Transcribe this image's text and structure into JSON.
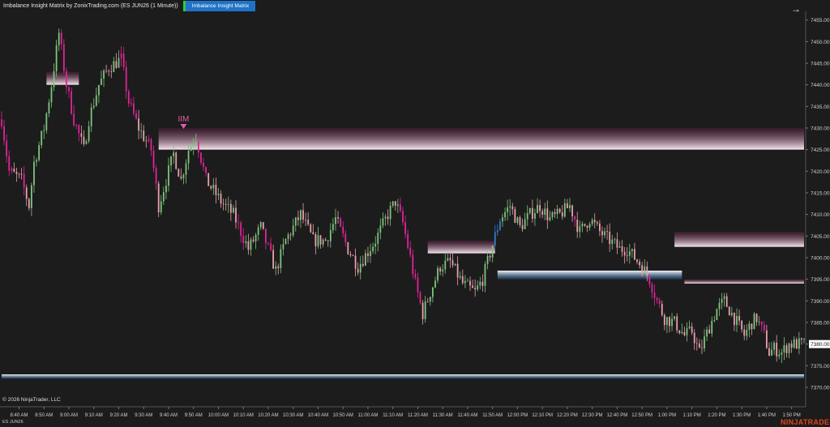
{
  "header": {
    "title": "Imbalance Insight Matrix by ZonixTrading.com (ES JUN26 (1 Minute))",
    "indicator_button": "Imbalance Insight Matrix"
  },
  "footer": {
    "copyright": "© 2026 NinjaTrader, LLC",
    "symbol": "ES JUN26",
    "brand": "NINJATRADER"
  },
  "colors": {
    "background": "#1c1c1c",
    "up_candle": "#7ec47e",
    "down_candle": "#e8a0ad",
    "magenta": "#e0249a",
    "blue": "#2d7fd1",
    "bearish_zone": "#f0dce8",
    "bullish_zone": "#d8e6f4",
    "price_marker": "#ffffff"
  },
  "chart_data": {
    "type": "candlestick",
    "ylim": [
      7370,
      7457
    ],
    "y_ticks": [
      "7455.00",
      "7450.00",
      "7445.00",
      "7440.00",
      "7435.00",
      "7430.00",
      "7425.00",
      "7420.00",
      "7415.00",
      "7410.00",
      "7405.00",
      "7400.00",
      "7395.00",
      "7390.00",
      "7385.00",
      "7380.00",
      "7375.00",
      "7370.00"
    ],
    "x_ticks": [
      "8:40 AM",
      "8:50 AM",
      "9:00 AM",
      "9:10 AM",
      "9:20 AM",
      "9:30 AM",
      "9:40 AM",
      "9:50 AM",
      "10:00 AM",
      "10:10 AM",
      "10:20 AM",
      "10:30 AM",
      "10:40 AM",
      "10:50 AM",
      "11:00 AM",
      "11:10 AM",
      "11:20 AM",
      "11:30 AM",
      "11:40 AM",
      "11:50 AM",
      "12:00 PM",
      "12:10 PM",
      "12:20 PM",
      "12:30 PM",
      "12:40 PM",
      "12:50 PM",
      "1:00 PM",
      "1:10 PM",
      "1:20 PM",
      "1:30 PM",
      "1:40 PM",
      "1:50 PM"
    ],
    "start_time": "8:33 AM",
    "end_time": "1:55 PM",
    "current_price": "7380.00",
    "price_path": [
      [
        0,
        7432
      ],
      [
        3,
        7420
      ],
      [
        8,
        7418
      ],
      [
        11,
        7412
      ],
      [
        13,
        7422
      ],
      [
        17,
        7430
      ],
      [
        20,
        7440
      ],
      [
        23,
        7452
      ],
      [
        26,
        7440
      ],
      [
        29,
        7432
      ],
      [
        33,
        7425
      ],
      [
        35,
        7432
      ],
      [
        39,
        7440
      ],
      [
        43,
        7444
      ],
      [
        48,
        7446
      ],
      [
        51,
        7436
      ],
      [
        55,
        7430
      ],
      [
        60,
        7425
      ],
      [
        63,
        7412
      ],
      [
        66,
        7418
      ],
      [
        69,
        7424
      ],
      [
        72,
        7418
      ],
      [
        75,
        7425
      ],
      [
        78,
        7428
      ],
      [
        82,
        7418
      ],
      [
        88,
        7413
      ],
      [
        93,
        7410
      ],
      [
        99,
        7402
      ],
      [
        104,
        7407
      ],
      [
        110,
        7397
      ],
      [
        114,
        7404
      ],
      [
        120,
        7410
      ],
      [
        125,
        7404
      ],
      [
        130,
        7404
      ],
      [
        134,
        7409
      ],
      [
        139,
        7402
      ],
      [
        143,
        7398
      ],
      [
        150,
        7404
      ],
      [
        155,
        7410
      ],
      [
        158,
        7413
      ],
      [
        161,
        7408
      ],
      [
        164,
        7400
      ],
      [
        166,
        7394
      ],
      [
        169,
        7387
      ],
      [
        172,
        7392
      ],
      [
        176,
        7398
      ],
      [
        180,
        7399
      ],
      [
        185,
        7394
      ],
      [
        190,
        7392
      ],
      [
        193,
        7395
      ],
      [
        197,
        7403
      ],
      [
        200,
        7409
      ],
      [
        204,
        7412
      ],
      [
        208,
        7407
      ],
      [
        212,
        7410
      ],
      [
        216,
        7412
      ],
      [
        220,
        7409
      ],
      [
        224,
        7410
      ],
      [
        228,
        7412
      ],
      [
        232,
        7406
      ],
      [
        236,
        7409
      ],
      [
        240,
        7406
      ],
      [
        244,
        7404
      ],
      [
        248,
        7402
      ],
      [
        251,
        7402
      ],
      [
        254,
        7400
      ],
      [
        257,
        7398
      ],
      [
        260,
        7395
      ],
      [
        263,
        7390
      ],
      [
        266,
        7386
      ],
      [
        270,
        7385
      ],
      [
        274,
        7382
      ],
      [
        277,
        7383
      ],
      [
        280,
        7378
      ],
      [
        284,
        7384
      ],
      [
        287,
        7388
      ],
      [
        290,
        7390
      ],
      [
        294,
        7386
      ],
      [
        298,
        7382
      ],
      [
        301,
        7385
      ],
      [
        303,
        7386
      ],
      [
        306,
        7382
      ],
      [
        308,
        7378
      ],
      [
        310,
        7379
      ],
      [
        313,
        7378
      ],
      [
        316,
        7380
      ],
      [
        322,
        7380
      ]
    ],
    "zones": [
      {
        "kind": "bearish",
        "from": "8:51 AM",
        "to": "9:04 AM",
        "top": 7443,
        "bottom": 7440
      },
      {
        "kind": "bearish",
        "from": "9:36 AM",
        "to": "1:55 PM",
        "top": 7430,
        "bottom": 7425
      },
      {
        "kind": "bearish",
        "from": "11:24 AM",
        "to": "11:51 AM",
        "top": 7404,
        "bottom": 7401
      },
      {
        "kind": "bullish",
        "from": "11:52 AM",
        "to": "1:06 PM",
        "top": 7397,
        "bottom": 7395
      },
      {
        "kind": "bearish",
        "from": "1:03 PM",
        "to": "1:55 PM",
        "top": 7406,
        "bottom": 7402.5
      },
      {
        "kind": "bearish",
        "from": "1:07 PM",
        "to": "1:55 PM",
        "top": 7395,
        "bottom": 7394
      },
      {
        "kind": "bullish",
        "from": "8:33 AM",
        "to": "1:55 PM",
        "top": 7373,
        "bottom": 7372
      }
    ],
    "annotations": [
      {
        "text": "IIM",
        "time": "9:46 AM",
        "price": 7430
      }
    ]
  }
}
